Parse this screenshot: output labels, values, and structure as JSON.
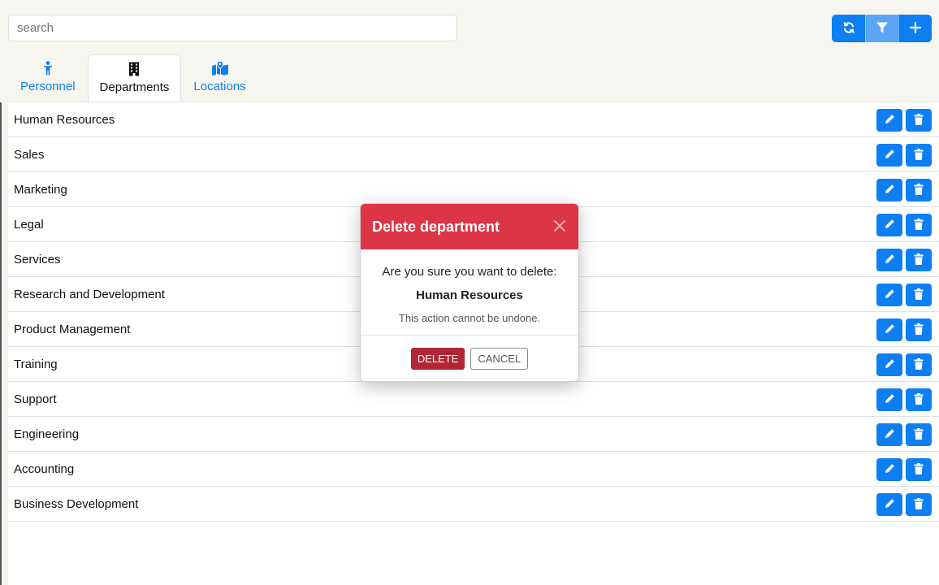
{
  "search": {
    "placeholder": "search"
  },
  "toolbar": {
    "refresh_icon": "refresh-icon",
    "filter_icon": "filter-icon",
    "add_icon": "plus-icon"
  },
  "tabs": [
    {
      "label": "Personnel",
      "icon": "person-icon",
      "active": false
    },
    {
      "label": "Departments",
      "icon": "building-icon",
      "active": true
    },
    {
      "label": "Locations",
      "icon": "map-location-icon",
      "active": false
    }
  ],
  "departments": [
    {
      "name": "Human Resources"
    },
    {
      "name": "Sales"
    },
    {
      "name": "Marketing"
    },
    {
      "name": "Legal"
    },
    {
      "name": "Services"
    },
    {
      "name": "Research and Development"
    },
    {
      "name": "Product Management"
    },
    {
      "name": "Training"
    },
    {
      "name": "Support"
    },
    {
      "name": "Engineering"
    },
    {
      "name": "Accounting"
    },
    {
      "name": "Business Development"
    }
  ],
  "modal": {
    "title": "Delete department",
    "confirm_text": "Are you sure you want to delete:",
    "department_name": "Human Resources",
    "warning": "This action cannot be undone.",
    "delete_label": "DELETE",
    "cancel_label": "CANCEL"
  },
  "colors": {
    "primary": "#0d7ff2",
    "danger": "#dc3545",
    "danger_dark": "#b22534",
    "header_bg": "#f7f5ef"
  }
}
